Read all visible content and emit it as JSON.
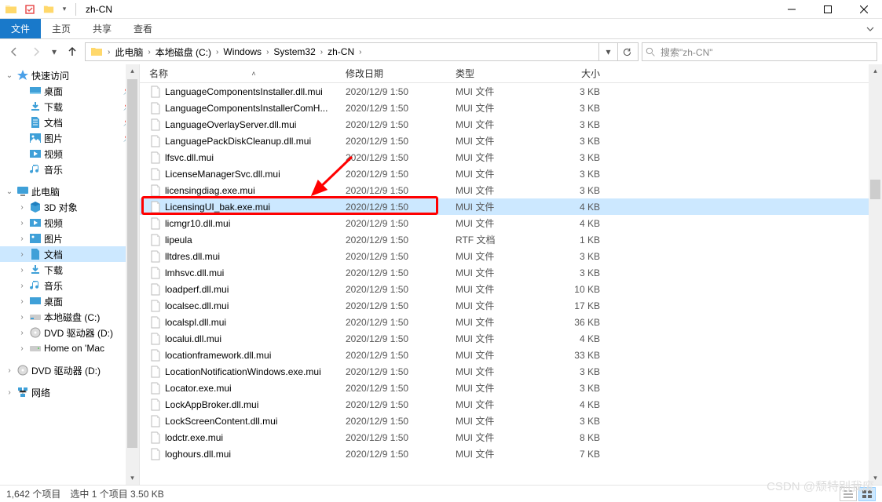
{
  "title": "zh-CN",
  "ribbon": {
    "file": "文件",
    "home": "主页",
    "share": "共享",
    "view": "查看"
  },
  "breadcrumb": [
    "此电脑",
    "本地磁盘 (C:)",
    "Windows",
    "System32",
    "zh-CN"
  ],
  "search_placeholder": "搜索\"zh-CN\"",
  "columns": {
    "name": "名称",
    "date": "修改日期",
    "type": "类型",
    "size": "大小"
  },
  "tree": {
    "quick": "快速访问",
    "desktop": "桌面",
    "downloads": "下载",
    "documents": "文档",
    "pictures": "图片",
    "videos": "视频",
    "music": "音乐",
    "pc": "此电脑",
    "objects3d": "3D 对象",
    "local_c": "本地磁盘 (C:)",
    "dvd_d": "DVD 驱动器 (D:)",
    "home_mac": "Home on 'Mac",
    "network": "网络"
  },
  "files": [
    {
      "name": "LanguageComponentsInstaller.dll.mui",
      "date": "2020/12/9 1:50",
      "type": "MUI 文件",
      "size": "3 KB"
    },
    {
      "name": "LanguageComponentsInstallerComH...",
      "date": "2020/12/9 1:50",
      "type": "MUI 文件",
      "size": "3 KB"
    },
    {
      "name": "LanguageOverlayServer.dll.mui",
      "date": "2020/12/9 1:50",
      "type": "MUI 文件",
      "size": "3 KB"
    },
    {
      "name": "LanguagePackDiskCleanup.dll.mui",
      "date": "2020/12/9 1:50",
      "type": "MUI 文件",
      "size": "3 KB"
    },
    {
      "name": "lfsvc.dll.mui",
      "date": "2020/12/9 1:50",
      "type": "MUI 文件",
      "size": "3 KB"
    },
    {
      "name": "LicenseManagerSvc.dll.mui",
      "date": "2020/12/9 1:50",
      "type": "MUI 文件",
      "size": "3 KB"
    },
    {
      "name": "licensingdiag.exe.mui",
      "date": "2020/12/9 1:50",
      "type": "MUI 文件",
      "size": "3 KB"
    },
    {
      "name": "LicensingUI_bak.exe.mui",
      "date": "2020/12/9 1:50",
      "type": "MUI 文件",
      "size": "4 KB",
      "selected": true
    },
    {
      "name": "licmgr10.dll.mui",
      "date": "2020/12/9 1:50",
      "type": "MUI 文件",
      "size": "4 KB"
    },
    {
      "name": "lipeula",
      "date": "2020/12/9 1:50",
      "type": "RTF 文档",
      "size": "1 KB"
    },
    {
      "name": "lltdres.dll.mui",
      "date": "2020/12/9 1:50",
      "type": "MUI 文件",
      "size": "3 KB"
    },
    {
      "name": "lmhsvc.dll.mui",
      "date": "2020/12/9 1:50",
      "type": "MUI 文件",
      "size": "3 KB"
    },
    {
      "name": "loadperf.dll.mui",
      "date": "2020/12/9 1:50",
      "type": "MUI 文件",
      "size": "10 KB"
    },
    {
      "name": "localsec.dll.mui",
      "date": "2020/12/9 1:50",
      "type": "MUI 文件",
      "size": "17 KB"
    },
    {
      "name": "localspl.dll.mui",
      "date": "2020/12/9 1:50",
      "type": "MUI 文件",
      "size": "36 KB"
    },
    {
      "name": "localui.dll.mui",
      "date": "2020/12/9 1:50",
      "type": "MUI 文件",
      "size": "4 KB"
    },
    {
      "name": "locationframework.dll.mui",
      "date": "2020/12/9 1:50",
      "type": "MUI 文件",
      "size": "33 KB"
    },
    {
      "name": "LocationNotificationWindows.exe.mui",
      "date": "2020/12/9 1:50",
      "type": "MUI 文件",
      "size": "3 KB"
    },
    {
      "name": "Locator.exe.mui",
      "date": "2020/12/9 1:50",
      "type": "MUI 文件",
      "size": "3 KB"
    },
    {
      "name": "LockAppBroker.dll.mui",
      "date": "2020/12/9 1:50",
      "type": "MUI 文件",
      "size": "4 KB"
    },
    {
      "name": "LockScreenContent.dll.mui",
      "date": "2020/12/9 1:50",
      "type": "MUI 文件",
      "size": "3 KB"
    },
    {
      "name": "lodctr.exe.mui",
      "date": "2020/12/9 1:50",
      "type": "MUI 文件",
      "size": "8 KB"
    },
    {
      "name": "loghours.dll.mui",
      "date": "2020/12/9 1:50",
      "type": "MUI 文件",
      "size": "7 KB"
    }
  ],
  "status": {
    "count": "1,642 个项目",
    "selected": "选中 1 个项目 3.50 KB"
  },
  "watermark": "CSDN @颓特别我废"
}
